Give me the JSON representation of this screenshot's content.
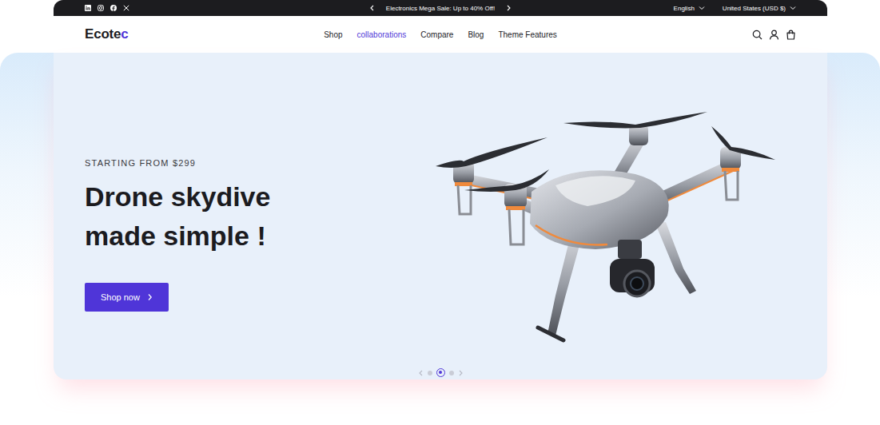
{
  "announcement": {
    "text": "Electronics Mega Sale: Up to 40% Off!"
  },
  "language": "English",
  "currency": "United States (USD $)",
  "logo": {
    "text": "Ecote",
    "accent": "c"
  },
  "nav": [
    {
      "label": "Shop",
      "selected": false
    },
    {
      "label": "collaborations",
      "selected": true
    },
    {
      "label": "Compare",
      "selected": false
    },
    {
      "label": "Blog",
      "selected": false
    },
    {
      "label": "Theme Features",
      "selected": false
    }
  ],
  "hero": {
    "eyebrow": "STARTING FROM $299",
    "title_lines": [
      "Drone skydive",
      "made simple !"
    ],
    "button": "Shop now"
  },
  "slider": {
    "dots": [
      {
        "selected": false
      },
      {
        "selected": true
      },
      {
        "selected": false
      }
    ]
  }
}
